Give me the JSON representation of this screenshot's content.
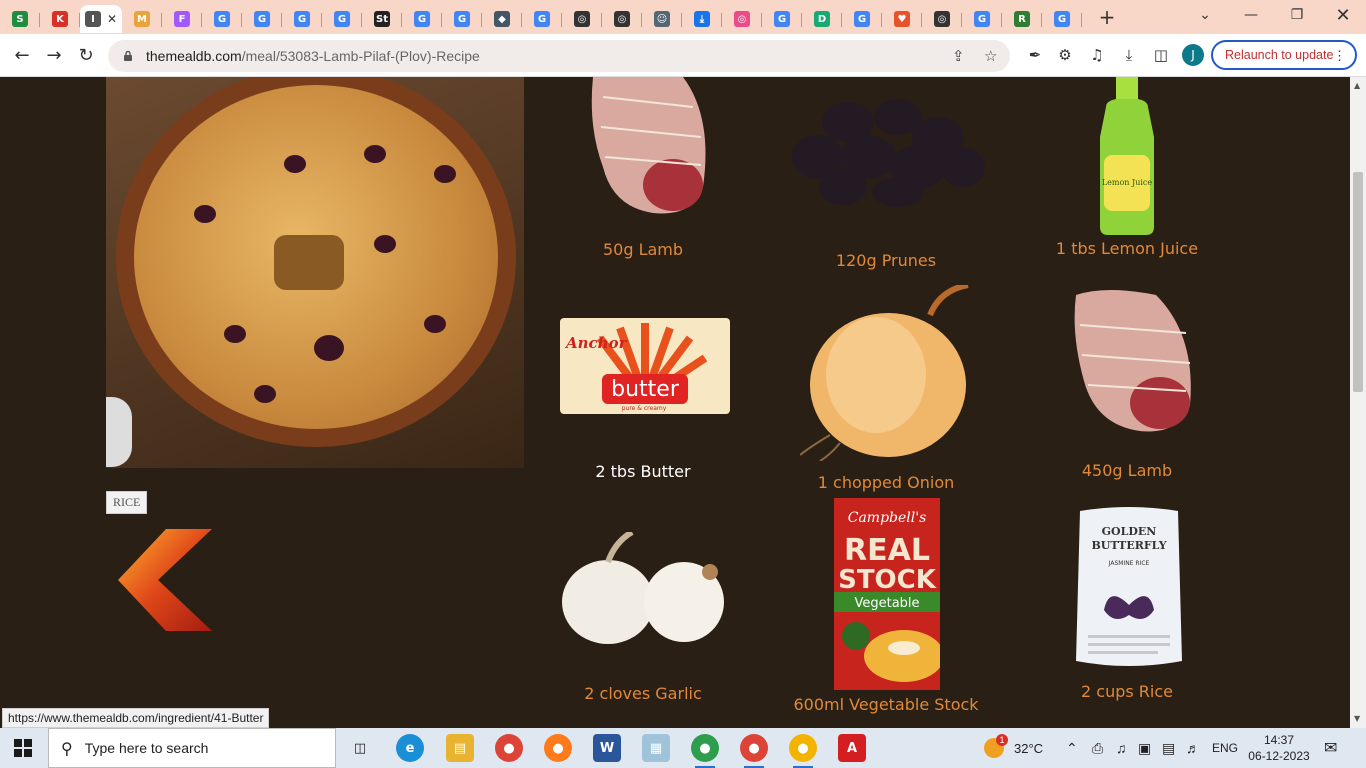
{
  "browser": {
    "tabs": [
      {
        "icon": "sheets-icon",
        "color": "#1e8e3e",
        "glyph": "S"
      },
      {
        "icon": "red-dot-icon",
        "color": "#d93025",
        "glyph": "K"
      },
      {
        "icon": "active-tab-icon",
        "color": "#555555",
        "glyph": "I",
        "active": true
      },
      {
        "icon": "themealdb-icon",
        "color": "#e8a33d",
        "glyph": "M"
      },
      {
        "icon": "figma-icon",
        "color": "#a259ff",
        "glyph": "F"
      },
      {
        "icon": "google-icon",
        "color": "#4285f4",
        "glyph": "G"
      },
      {
        "icon": "google-icon",
        "color": "#4285f4",
        "glyph": "G"
      },
      {
        "icon": "google-icon",
        "color": "#4285f4",
        "glyph": "G"
      },
      {
        "icon": "google-icon",
        "color": "#4285f4",
        "glyph": "G"
      },
      {
        "icon": "st-icon",
        "color": "#222222",
        "glyph": "St"
      },
      {
        "icon": "google-icon",
        "color": "#4285f4",
        "glyph": "G"
      },
      {
        "icon": "google-icon",
        "color": "#4285f4",
        "glyph": "G"
      },
      {
        "icon": "cap-icon",
        "color": "#445566",
        "glyph": "◆"
      },
      {
        "icon": "google-icon",
        "color": "#4285f4",
        "glyph": "G"
      },
      {
        "icon": "github-icon",
        "color": "#333333",
        "glyph": "◎"
      },
      {
        "icon": "github-icon",
        "color": "#333333",
        "glyph": "◎"
      },
      {
        "icon": "profile-icon",
        "color": "#556677",
        "glyph": "☺"
      },
      {
        "icon": "download-icon",
        "color": "#1a73e8",
        "glyph": "⤓"
      },
      {
        "icon": "dribbble-icon",
        "color": "#ea4c89",
        "glyph": "◎"
      },
      {
        "icon": "google-icon",
        "color": "#4285f4",
        "glyph": "G"
      },
      {
        "icon": "d-icon",
        "color": "#19a974",
        "glyph": "D"
      },
      {
        "icon": "google-icon",
        "color": "#4285f4",
        "glyph": "G"
      },
      {
        "icon": "heart-icon",
        "color": "#e8522a",
        "glyph": "♥"
      },
      {
        "icon": "github-icon",
        "color": "#333333",
        "glyph": "◎"
      },
      {
        "icon": "google-icon",
        "color": "#4285f4",
        "glyph": "G"
      },
      {
        "icon": "r-icon",
        "color": "#2e7d32",
        "glyph": "R"
      },
      {
        "icon": "google-icon",
        "color": "#4285f4",
        "glyph": "G"
      }
    ],
    "new_tab": "+",
    "url_domain": "themealdb.com",
    "url_path": "/meal/53083-Lamb-Pilaf-(Plov)-Recipe",
    "profile_initial": "J",
    "relaunch_label": "Relaunch to update",
    "status_url": "https://www.themealdb.com/ingredient/41-Butter"
  },
  "meal": {
    "tag": "RICE"
  },
  "ingredients": [
    {
      "label": "50g Lamb"
    },
    {
      "label": "120g Prunes"
    },
    {
      "label": "1 tbs Lemon Juice"
    },
    {
      "label": "2 tbs Butter",
      "hover": true
    },
    {
      "label": "1 chopped Onion"
    },
    {
      "label": "450g Lamb"
    },
    {
      "label": "2 cloves Garlic"
    },
    {
      "label": "600ml Vegetable Stock"
    },
    {
      "label": "2 cups Rice"
    }
  ],
  "product_text": {
    "butter_brand": "Anchor",
    "butter_word": "butter",
    "butter_sub": "pure & creamy",
    "stock_brand": "Campbell's",
    "stock_line1": "REAL",
    "stock_line2": "STOCK",
    "stock_variant": "Vegetable",
    "rice_brand1": "GOLDEN",
    "rice_brand2": "BUTTERFLY",
    "rice_type": "JASMINE RICE",
    "lemon_label": "Lemon Juice"
  },
  "taskbar": {
    "search_placeholder": "Type here to search",
    "weather_temp": "32°C",
    "weather_badge": "1",
    "language": "ENG",
    "time": "14:37",
    "date": "06-12-2023"
  }
}
